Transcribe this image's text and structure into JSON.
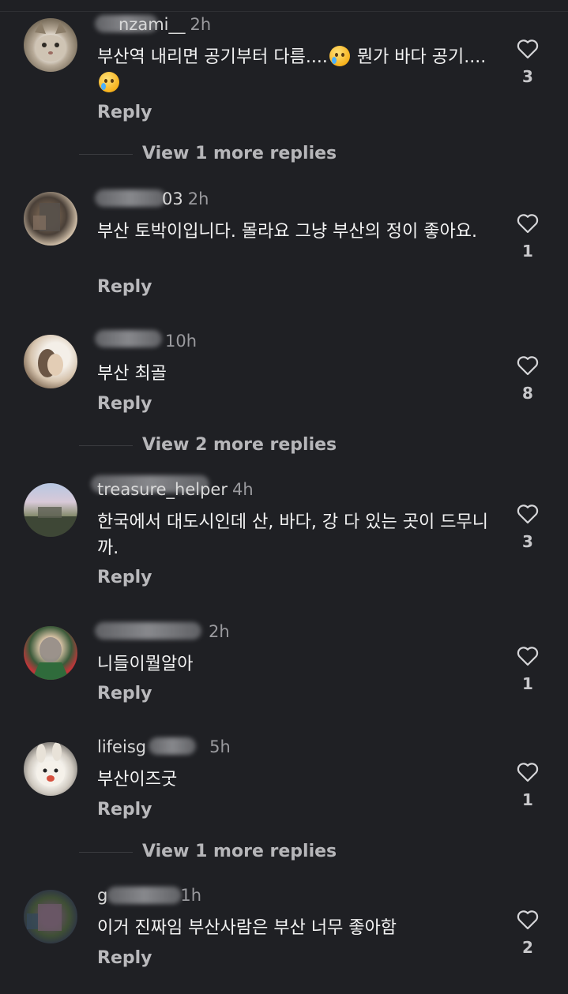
{
  "comments": [
    {
      "username": "nzami__",
      "time": "2h",
      "text": "부산역 내리면 공기부터 다름....",
      "text2": " 뭔가 바다 공기....",
      "reply": "Reply",
      "likes": "3",
      "avatar_icon": "cat-avatar"
    },
    {
      "username": "03",
      "time": "2h",
      "text": "부산 토박이입니다. 몰라요 그냥 부산의 정이 좋아요.",
      "reply": "Reply",
      "likes": "1",
      "avatar_icon": "blurred-avatar"
    },
    {
      "username": "",
      "time": "10h",
      "text": "부산 최골",
      "reply": "Reply",
      "likes": "8",
      "avatar_icon": "person-avatar"
    },
    {
      "username": "treasure_helper",
      "time": "4h",
      "text": "한국에서 대도시인데 산, 바다, 강 다 있는 곳이 드무니까.",
      "reply": "Reply",
      "likes": "3",
      "avatar_icon": "landscape-avatar"
    },
    {
      "username": "",
      "time": "2h",
      "text": "니들이뭘알아",
      "reply": "Reply",
      "likes": "1",
      "avatar_icon": "cartoon-avatar"
    },
    {
      "username": "lifeisg",
      "time": "5h",
      "text": "부산이즈굿",
      "reply": "Reply",
      "likes": "1",
      "avatar_icon": "rabbit-avatar"
    },
    {
      "username": "g",
      "time": "1h",
      "text": "이거 진짜임 부산사람은 부산 너무 좋아함",
      "reply": "Reply",
      "likes": "2",
      "avatar_icon": "blurred-avatar"
    }
  ],
  "view_more": [
    {
      "label": "View 1 more replies"
    },
    {
      "label": "View 2 more replies"
    },
    {
      "label": "View 1 more replies"
    }
  ],
  "colors": {
    "background": "#1f2024",
    "text": "#f3f3f3",
    "muted": "#b9b9bc"
  }
}
